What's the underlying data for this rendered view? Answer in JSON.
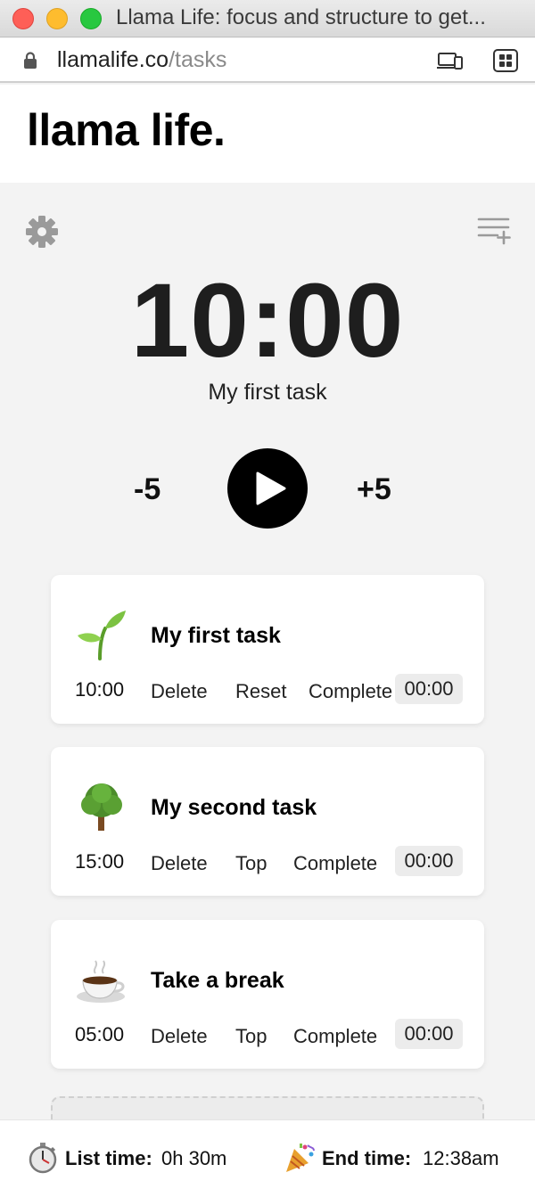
{
  "window": {
    "title": "Llama Life: focus and structure to get..."
  },
  "address": {
    "domain": "llamalife.co",
    "path": "/tasks"
  },
  "app": {
    "brand": "llama life."
  },
  "timer": {
    "display": "10:00",
    "current_task": "My first task",
    "minus_label": "-5",
    "plus_label": "+5"
  },
  "tasks": [
    {
      "name": "My first task",
      "emoji": "seedling-icon",
      "duration": "10:00",
      "actions": [
        "Delete",
        "Reset",
        "Complete"
      ],
      "elapsed": "00:00"
    },
    {
      "name": "My second task",
      "emoji": "tree-icon",
      "duration": "15:00",
      "actions": [
        "Delete",
        "Top",
        "Complete"
      ],
      "elapsed": "00:00"
    },
    {
      "name": "Take a break",
      "emoji": "coffee-icon",
      "duration": "05:00",
      "actions": [
        "Delete",
        "Top",
        "Complete"
      ],
      "elapsed": "00:00"
    }
  ],
  "footer": {
    "list_time_label": "List time:",
    "list_time": "0h 30m",
    "end_time_label": "End time:",
    "end_time": "12:38am"
  },
  "colors": {
    "accent": "#000000",
    "background": "#f3f3f3",
    "card": "#ffffff"
  }
}
